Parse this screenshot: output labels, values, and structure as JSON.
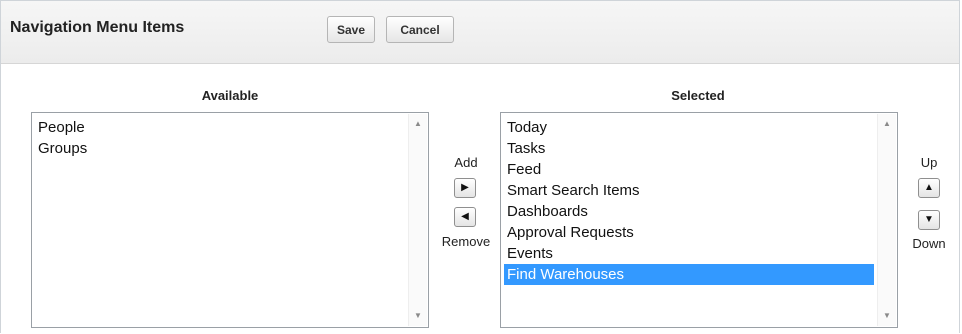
{
  "header": {
    "title": "Navigation Menu Items",
    "save_label": "Save",
    "cancel_label": "Cancel"
  },
  "available": {
    "label": "Available",
    "items": [
      "People",
      "Groups"
    ]
  },
  "selected": {
    "label": "Selected",
    "items": [
      "Today",
      "Tasks",
      "Feed",
      "Smart Search Items",
      "Dashboards",
      "Approval Requests",
      "Events",
      "Find Warehouses"
    ],
    "selected_item": "Find Warehouses"
  },
  "controls": {
    "add_label": "Add",
    "remove_label": "Remove",
    "up_label": "Up",
    "down_label": "Down"
  },
  "icons": {
    "add": "triangle-right-icon",
    "remove": "triangle-left-icon",
    "up": "triangle-up-icon",
    "down": "triangle-down-icon",
    "scroll_up": "scroll-up-icon",
    "scroll_down": "scroll-down-icon"
  },
  "colors": {
    "selection": "#3399ff",
    "header_bg": "#efefef"
  }
}
